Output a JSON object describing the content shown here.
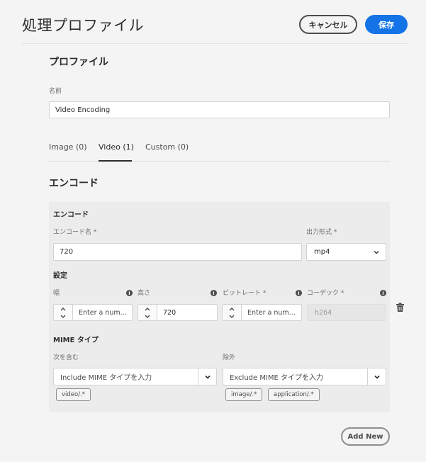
{
  "header": {
    "title": "処理プロファイル",
    "cancel_label": "キャンセル",
    "save_label": "保存"
  },
  "profile": {
    "section_title": "プロファイル",
    "name_label": "名前",
    "name_value": "Video Encoding"
  },
  "tabs": [
    {
      "label": "Image (0)",
      "active": false
    },
    {
      "label": "Video (1)",
      "active": true
    },
    {
      "label": "Custom (0)",
      "active": false
    }
  ],
  "encode": {
    "section_title": "エンコード",
    "panel_title": "エンコード",
    "encode_name_label": "エンコード名 *",
    "encode_name_value": "720",
    "output_format_label": "出力形式 *",
    "output_format_value": "mp4",
    "settings_title": "設定",
    "width_label": "幅",
    "width_placeholder": "Enter a num...",
    "height_label": "高さ",
    "height_value": "720",
    "bitrate_label": "ビットレート *",
    "bitrate_placeholder": "Enter a num...",
    "codec_label": "コーデック *",
    "codec_value": "h264"
  },
  "mime": {
    "title": "MIME タイプ",
    "include_label": "次を含む",
    "include_placeholder": "Include MIME タイプを入力",
    "include_tags": [
      "video/.*"
    ],
    "exclude_label": "除外",
    "exclude_placeholder": "Exclude MIME タイプを入力",
    "exclude_tags": [
      "image/.*",
      "application/.*"
    ]
  },
  "footer": {
    "add_new_label": "Add New"
  },
  "icons": {
    "info": "info-icon",
    "trash": "trash-icon",
    "chevron": "chevron-down-icon"
  },
  "colors": {
    "accent": "#1473e6",
    "background": "#f4f4f4",
    "panel": "#ececec"
  }
}
